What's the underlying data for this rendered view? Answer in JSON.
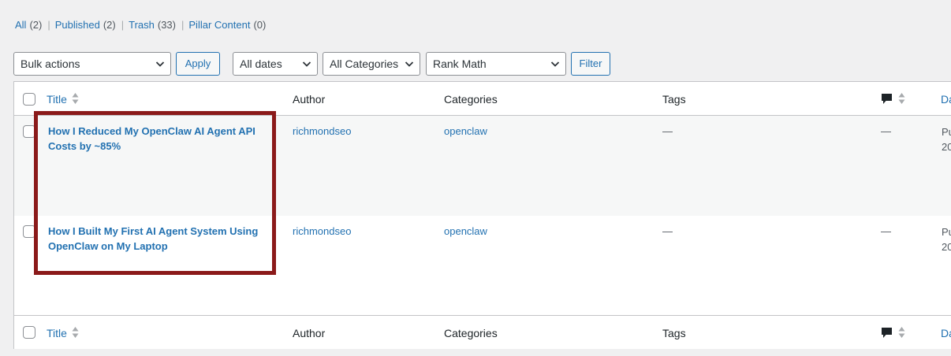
{
  "filters": [
    {
      "label": "All",
      "count": "(2)"
    },
    {
      "label": "Published",
      "count": "(2)"
    },
    {
      "label": "Trash",
      "count": "(33)"
    },
    {
      "label": "Pillar Content",
      "count": "(0)"
    }
  ],
  "separator": "|",
  "toolbar": {
    "bulk_actions": "Bulk actions",
    "apply": "Apply",
    "dates": "All dates",
    "categories": "All Categories",
    "seo": "Rank Math",
    "filter": "Filter"
  },
  "columns": {
    "title": "Title",
    "author": "Author",
    "categories": "Categories",
    "tags": "Tags",
    "date": "Da"
  },
  "rows": [
    {
      "title": "How I Reduced My OpenClaw AI Agent API Costs by ~85%",
      "author": "richmondseo",
      "category": "openclaw",
      "tags": "—",
      "comments": "—",
      "date_line1": "Pu",
      "date_line2": "20"
    },
    {
      "title": "How I Built My First AI Agent System Using OpenClaw on My Laptop",
      "author": "richmondseo",
      "category": "openclaw",
      "tags": "—",
      "comments": "—",
      "date_line1": "Pu",
      "date_line2": "20"
    }
  ],
  "colors": {
    "link": "#2271b1",
    "highlight": "#8b1a1a",
    "background": "#f0f0f1"
  },
  "icons": [
    "chevron-down-icon",
    "sort-arrows-icon",
    "comment-bubble-icon",
    "checkbox"
  ]
}
